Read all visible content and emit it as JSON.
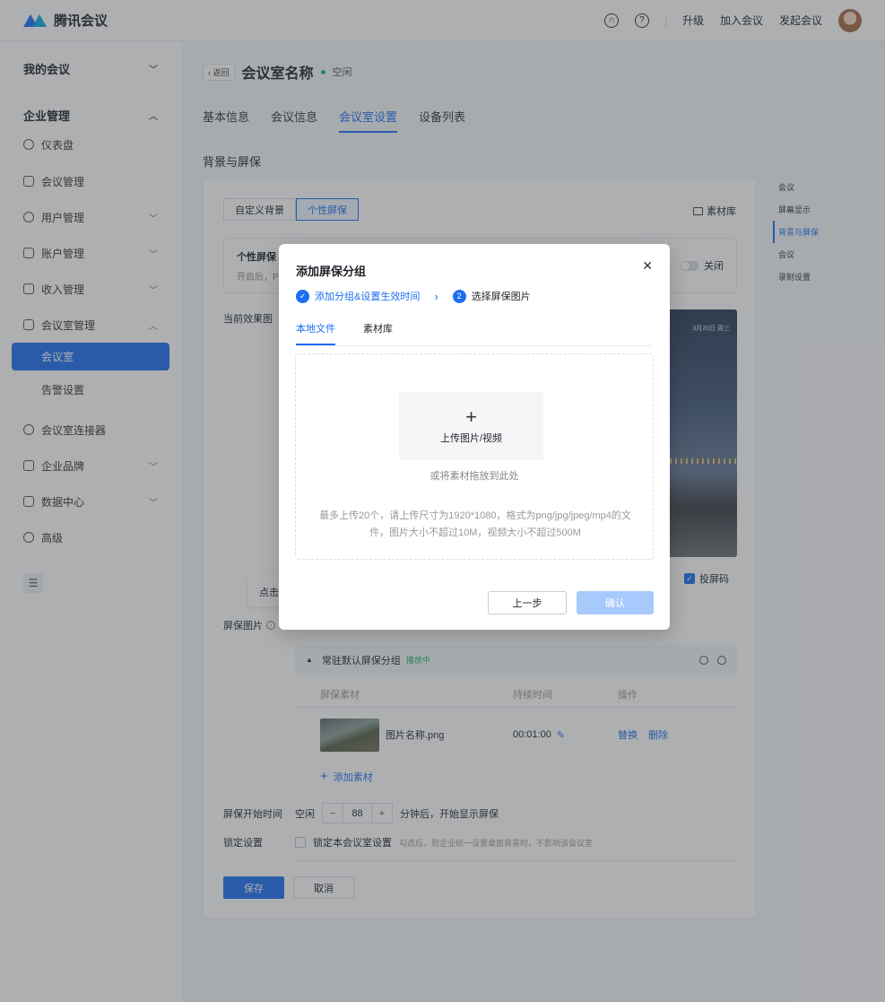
{
  "topbar": {
    "brand": "腾讯会议",
    "actions": [
      "升级",
      "加入会议",
      "发起会议"
    ]
  },
  "sidebar": {
    "my_meetings": "我的会议",
    "enterprise": "企业管理",
    "items": {
      "dashboard": "仪表盘",
      "meeting_mgmt": "会议管理",
      "user_mgmt": "用户管理",
      "account_mgmt": "账户管理",
      "income_mgmt": "收入管理",
      "room_mgmt": "会议室管理",
      "room": "会议室",
      "alert": "告警设置",
      "connector": "会议室连接器",
      "brand": "企业品牌",
      "data": "数据中心",
      "advanced": "高级"
    }
  },
  "header": {
    "back": "返回",
    "room_name": "会议室名称",
    "status": "空闲"
  },
  "tabs": [
    "基本信息",
    "会议信息",
    "会议室设置",
    "设备列表"
  ],
  "section_title": "背景与屏保",
  "card": {
    "seg_custom_bg": "自定义背景",
    "seg_screensaver": "个性屏保",
    "library": "素材库",
    "ps_title": "个性屏保",
    "ps_desc": "开启后，P",
    "toggle_label": "关闭",
    "preview_label": "当前效果图",
    "preview_date": "3月20日 周三",
    "cast_code": "投屏码",
    "click_tip": "点击",
    "screensaver_images": "屏保图片",
    "group_name": "常驻默认屏保分组",
    "group_status": "播放中",
    "col_material": "屏保素材",
    "col_duration": "持续时间",
    "col_ops": "操作",
    "file_name": "图片名称.png",
    "duration": "00:01:00",
    "replace": "替换",
    "delete": "删除",
    "add_material": "添加素材",
    "start_label": "屏保开始时间",
    "idle": "空闲",
    "minutes": "88",
    "after_text": "分钟后，开始显示屏保",
    "lock_label": "锁定设置",
    "lock_check": "锁定本会议室设置",
    "lock_hint": "勾选后，则企业统一设置桌面背景时，不影响该会议室",
    "save": "保存",
    "cancel": "取消"
  },
  "anchor": [
    "会议",
    "屏幕显示",
    "背景与屏保",
    "会议",
    "录制设置"
  ],
  "modal": {
    "title": "添加屏保分组",
    "step1": "添加分组&设置生效时间",
    "step2_num": "2",
    "step2": "选择屏保图片",
    "tab_local": "本地文件",
    "tab_library": "素材库",
    "upload_label": "上传图片/视频",
    "drag_text": "或将素材拖放到此处",
    "limit_text": "最多上传20个，请上传尺寸为1920*1080，格式为png/jpg/jpeg/mp4的文件，图片大小不超过10M，视频大小不超过500M",
    "prev": "上一步",
    "ok": "确认"
  },
  "colors": {
    "accent": "#1c6ef2",
    "success": "#19b36b"
  }
}
